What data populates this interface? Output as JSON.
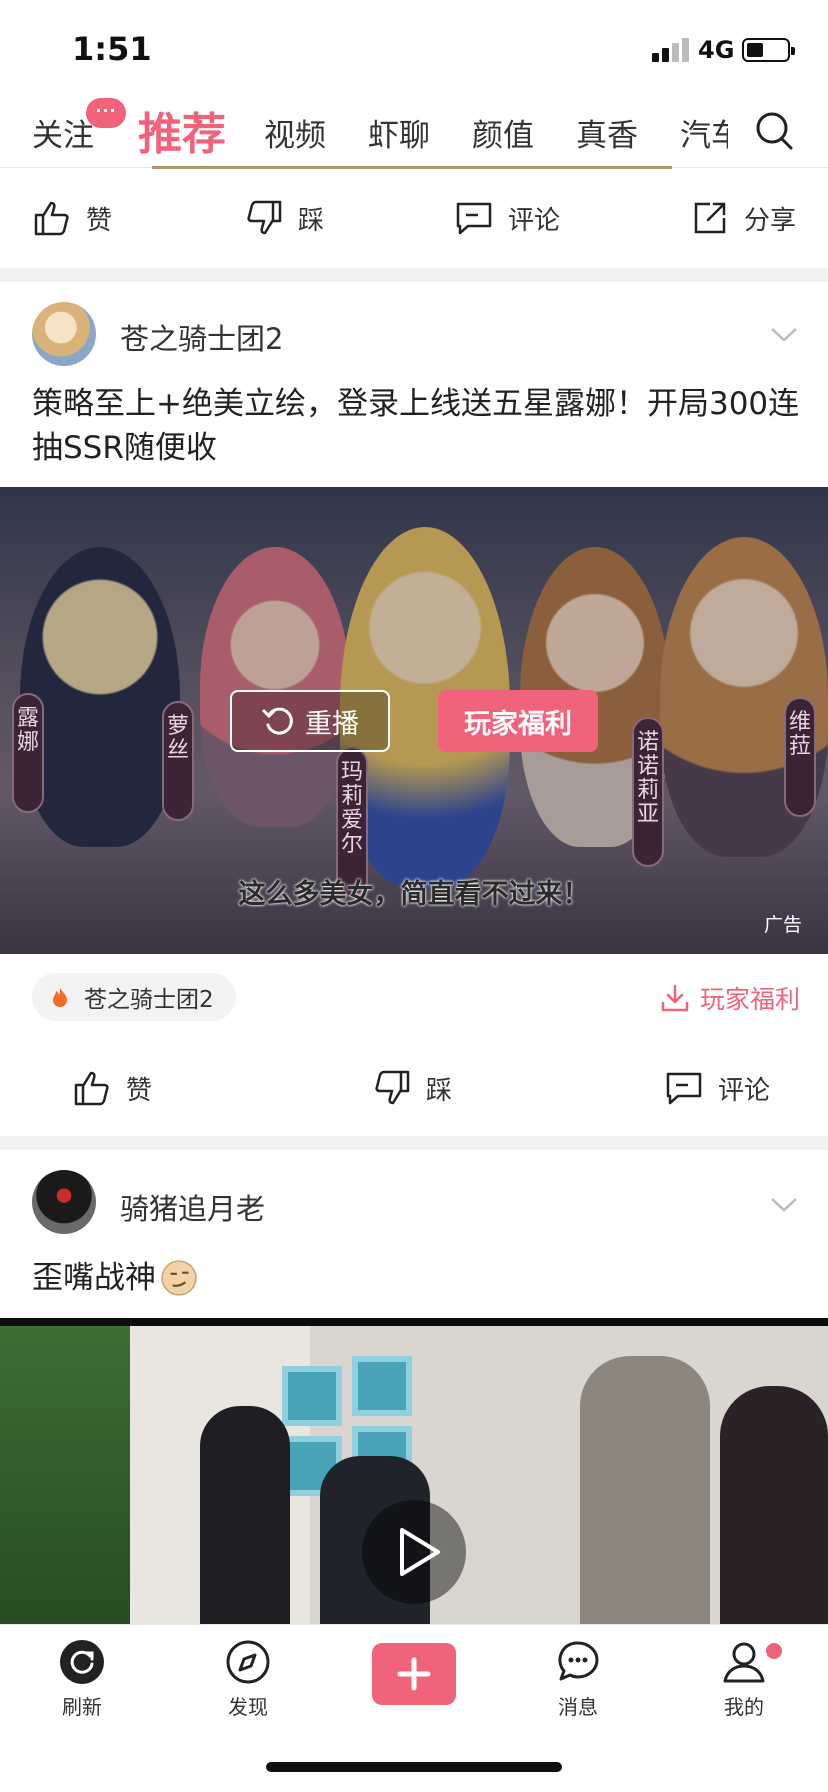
{
  "status": {
    "time": "1:51",
    "network": "4G"
  },
  "tabs": {
    "items": [
      "关注",
      "推荐",
      "视频",
      "虾聊",
      "颜值",
      "真香",
      "汽车"
    ],
    "active": "推荐",
    "badge": "···"
  },
  "actions_top": {
    "like": "赞",
    "dislike": "踩",
    "comment": "评论",
    "share": "分享"
  },
  "post1": {
    "author": "苍之骑士团2",
    "text": "策略至上+绝美立绘，登录上线送五星露娜！开局300连抽SSR随便收",
    "banners": [
      "露娜",
      "萝丝",
      "玛莉爱尔",
      "诺诺莉亚",
      "维菈"
    ],
    "replay_label": "重播",
    "cta_label": "玩家福利",
    "subtitle": "这么多美女，简直看不过来！",
    "ad_tag": "广告",
    "game_chip": "苍之骑士团2",
    "welfare_link": "玩家福利",
    "actions": {
      "like": "赞",
      "dislike": "踩",
      "comment": "评论"
    }
  },
  "post2": {
    "author": "骑猪追月老",
    "text": "歪嘴战神"
  },
  "bottom_nav": {
    "refresh": "刷新",
    "discover": "发现",
    "messages": "消息",
    "mine": "我的"
  },
  "colors": {
    "accent": "#f0637b"
  }
}
